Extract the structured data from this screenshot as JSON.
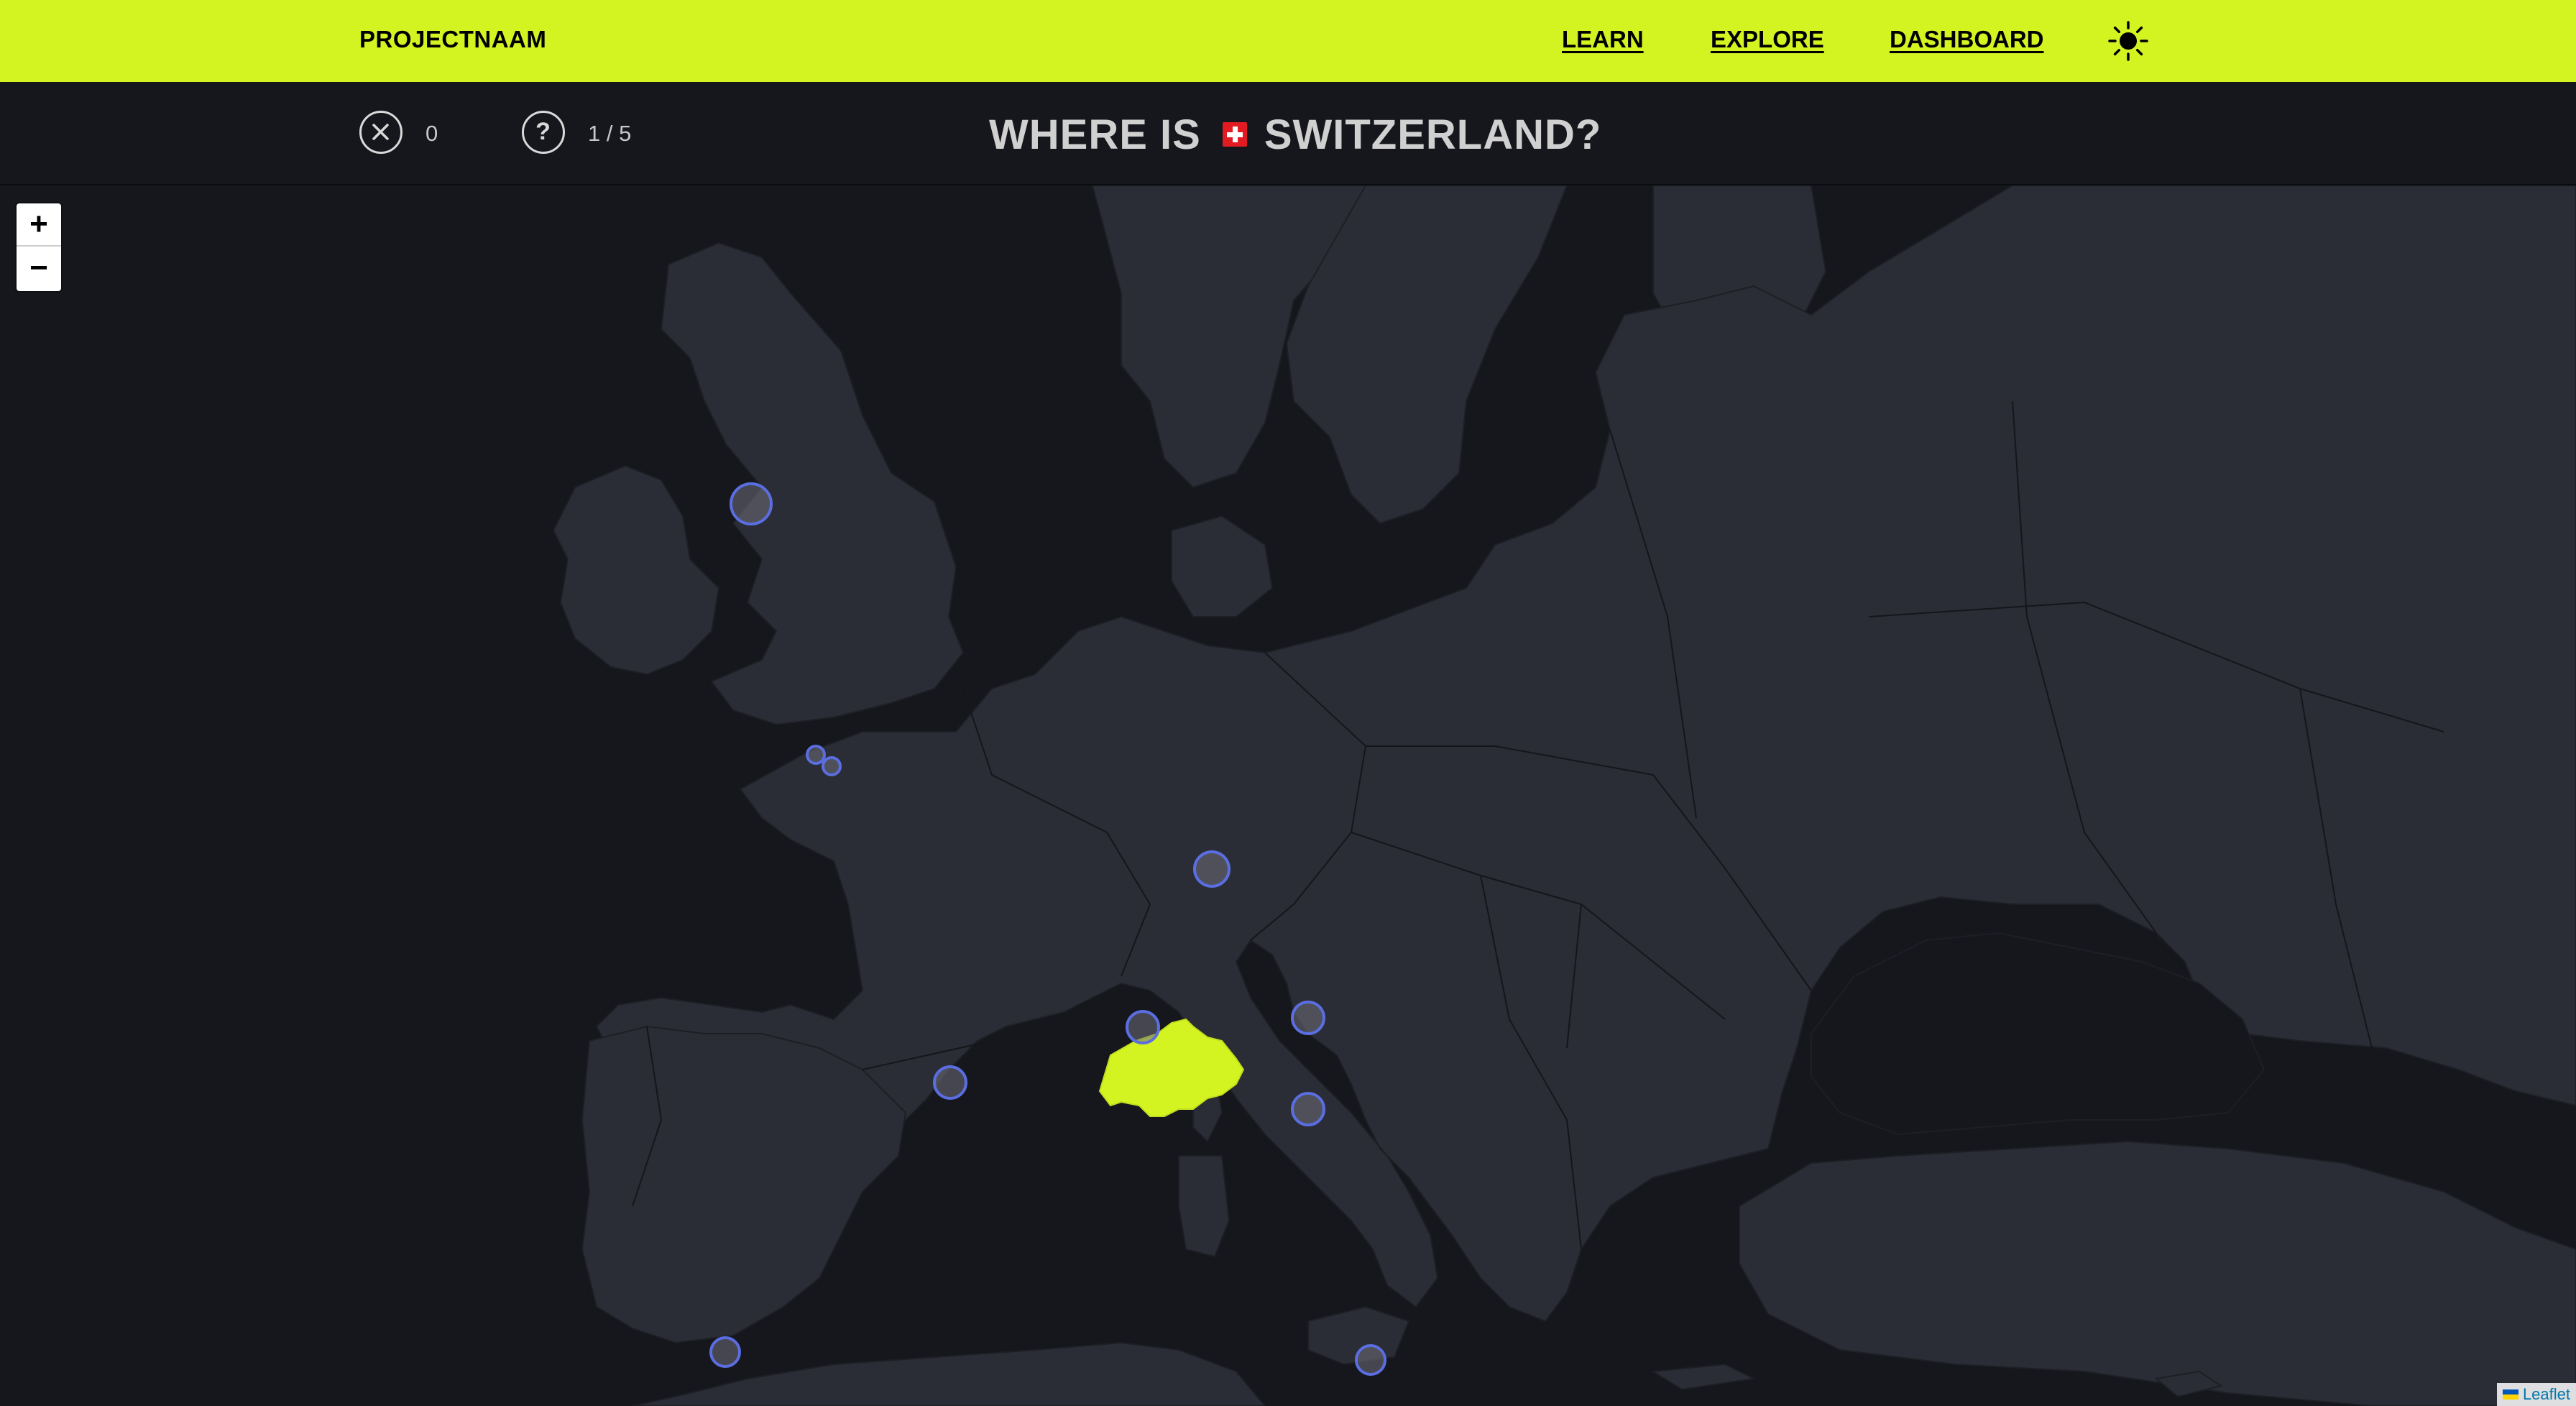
{
  "header": {
    "brand": "PROJECTNAAM",
    "nav": {
      "learn": "LEARN",
      "explore": "EXPLORE",
      "dashboard": "DASHBOARD"
    },
    "theme_icon": "sun-icon"
  },
  "game": {
    "wrong_count": "0",
    "progress": "1 / 5",
    "question_prefix": "WHERE IS",
    "country": "SWITZERLAND?",
    "flag_icon": "swiss-flag-icon"
  },
  "map": {
    "zoom_in": "+",
    "zoom_out": "−",
    "attribution": "Leaflet",
    "highlight_color": "#d4f422",
    "marker_color": "#5b6ee1",
    "land_color": "#2a2d35",
    "water_color": "#15171d",
    "marker_count": 11
  }
}
